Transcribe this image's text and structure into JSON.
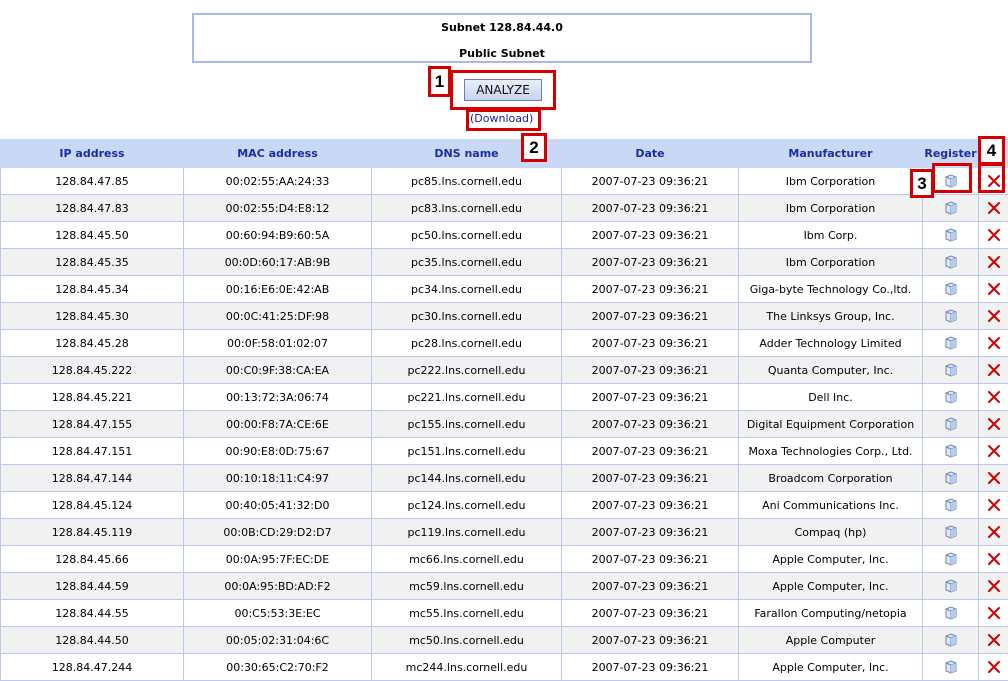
{
  "subnet": {
    "title": "Subnet 128.84.44.0",
    "description": "Public Subnet"
  },
  "actions": {
    "analyze_label": "ANALYZE",
    "download_label": "(Download)"
  },
  "callouts": [
    "1",
    "2",
    "3",
    "4"
  ],
  "table": {
    "headers": [
      "IP address",
      "MAC address",
      "DNS name",
      "Date",
      "Manufacturer",
      "Register",
      ""
    ],
    "rows": [
      {
        "ip": "128.84.47.85",
        "mac": "00:02:55:AA:24:33",
        "dns": "pc85.lns.cornell.edu",
        "date": "2007-07-23 09:36:21",
        "manufacturer": "Ibm Corporation"
      },
      {
        "ip": "128.84.47.83",
        "mac": "00:02:55:D4:E8:12",
        "dns": "pc83.lns.cornell.edu",
        "date": "2007-07-23 09:36:21",
        "manufacturer": "Ibm Corporation"
      },
      {
        "ip": "128.84.45.50",
        "mac": "00:60:94:B9:60:5A",
        "dns": "pc50.lns.cornell.edu",
        "date": "2007-07-23 09:36:21",
        "manufacturer": "Ibm Corp."
      },
      {
        "ip": "128.84.45.35",
        "mac": "00:0D:60:17:AB:9B",
        "dns": "pc35.lns.cornell.edu",
        "date": "2007-07-23 09:36:21",
        "manufacturer": "Ibm Corporation"
      },
      {
        "ip": "128.84.45.34",
        "mac": "00:16:E6:0E:42:AB",
        "dns": "pc34.lns.cornell.edu",
        "date": "2007-07-23 09:36:21",
        "manufacturer": "Giga-byte Technology Co.,ltd."
      },
      {
        "ip": "128.84.45.30",
        "mac": "00:0C:41:25:DF:98",
        "dns": "pc30.lns.cornell.edu",
        "date": "2007-07-23 09:36:21",
        "manufacturer": "The Linksys Group, Inc."
      },
      {
        "ip": "128.84.45.28",
        "mac": "00:0F:58:01:02:07",
        "dns": "pc28.lns.cornell.edu",
        "date": "2007-07-23 09:36:21",
        "manufacturer": "Adder Technology Limited"
      },
      {
        "ip": "128.84.45.222",
        "mac": "00:C0:9F:38:CA:EA",
        "dns": "pc222.lns.cornell.edu",
        "date": "2007-07-23 09:36:21",
        "manufacturer": "Quanta Computer, Inc."
      },
      {
        "ip": "128.84.45.221",
        "mac": "00:13:72:3A:06:74",
        "dns": "pc221.lns.cornell.edu",
        "date": "2007-07-23 09:36:21",
        "manufacturer": "Dell Inc."
      },
      {
        "ip": "128.84.47.155",
        "mac": "00:00:F8:7A:CE:6E",
        "dns": "pc155.lns.cornell.edu",
        "date": "2007-07-23 09:36:21",
        "manufacturer": "Digital Equipment Corporation"
      },
      {
        "ip": "128.84.47.151",
        "mac": "00:90:E8:0D:75:67",
        "dns": "pc151.lns.cornell.edu",
        "date": "2007-07-23 09:36:21",
        "manufacturer": "Moxa Technologies Corp., Ltd."
      },
      {
        "ip": "128.84.47.144",
        "mac": "00:10:18:11:C4:97",
        "dns": "pc144.lns.cornell.edu",
        "date": "2007-07-23 09:36:21",
        "manufacturer": "Broadcom Corporation"
      },
      {
        "ip": "128.84.45.124",
        "mac": "00:40:05:41:32:D0",
        "dns": "pc124.lns.cornell.edu",
        "date": "2007-07-23 09:36:21",
        "manufacturer": "Ani Communications Inc."
      },
      {
        "ip": "128.84.45.119",
        "mac": "00:0B:CD:29:D2:D7",
        "dns": "pc119.lns.cornell.edu",
        "date": "2007-07-23 09:36:21",
        "manufacturer": "Compaq (hp)"
      },
      {
        "ip": "128.84.45.66",
        "mac": "00:0A:95:7F:EC:DE",
        "dns": "mc66.lns.cornell.edu",
        "date": "2007-07-23 09:36:21",
        "manufacturer": "Apple Computer, Inc."
      },
      {
        "ip": "128.84.44.59",
        "mac": "00:0A:95:BD:AD:F2",
        "dns": "mc59.lns.cornell.edu",
        "date": "2007-07-23 09:36:21",
        "manufacturer": "Apple Computer, Inc."
      },
      {
        "ip": "128.84.44.55",
        "mac": "00:C5:53:3E:EC",
        "dns": "mc55.lns.cornell.edu",
        "date": "2007-07-23 09:36:21",
        "manufacturer": "Farallon Computing/netopia"
      },
      {
        "ip": "128.84.44.50",
        "mac": "00:05:02:31:04:6C",
        "dns": "mc50.lns.cornell.edu",
        "date": "2007-07-23 09:36:21",
        "manufacturer": "Apple Computer"
      },
      {
        "ip": "128.84.47.244",
        "mac": "00:30:65:C2:70:F2",
        "dns": "mc244.lns.cornell.edu",
        "date": "2007-07-23 09:36:21",
        "manufacturer": "Apple Computer, Inc."
      }
    ]
  },
  "icons": {
    "register": "register-box-icon",
    "delete": "delete-x-icon"
  },
  "colors": {
    "header_bg": "#c9d8f5",
    "header_text": "#1b2ca8",
    "callout": "#d40000",
    "delete": "#cc0000"
  }
}
